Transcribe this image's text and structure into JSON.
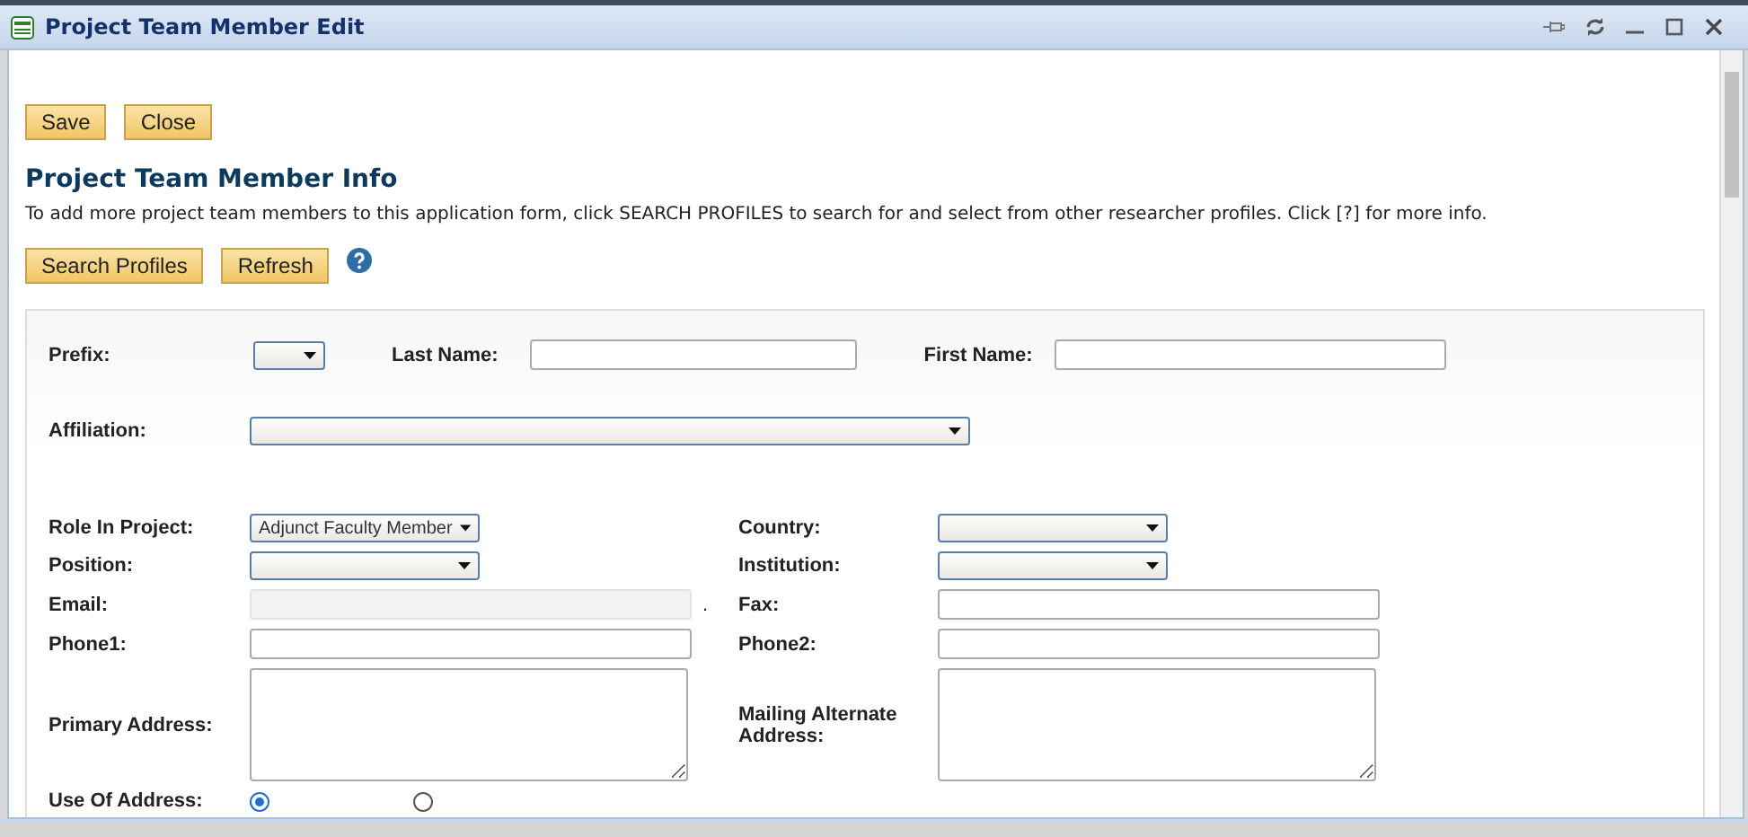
{
  "window": {
    "title": "Project Team Member Edit"
  },
  "toolbar": [
    "Save",
    "Close"
  ],
  "section": {
    "title": "Project Team Member Info",
    "description": "To add more project team members to this application form, click SEARCH PROFILES to search for and select from other researcher profiles. Click [?] for more info."
  },
  "actions": [
    "Search Profiles",
    "Refresh"
  ],
  "form": {
    "name_row": [
      {
        "label": "Prefix:",
        "kind": "select"
      },
      {
        "label": "Last Name:",
        "kind": "text"
      },
      {
        "label": "First Name:",
        "kind": "text"
      }
    ],
    "affiliation": {
      "label": "Affiliation:",
      "kind": "select"
    },
    "rows": [
      {
        "left": {
          "label": "Role In Project:",
          "kind": "select",
          "value": "Adjunct Faculty Member"
        },
        "right": {
          "label": "Country:",
          "kind": "select"
        }
      },
      {
        "left": {
          "label": "Position:",
          "kind": "select"
        },
        "right": {
          "label": "Institution:",
          "kind": "select"
        }
      },
      {
        "left": {
          "label": "Email:",
          "kind": "text",
          "disabled": true,
          "note": "."
        },
        "right": {
          "label": "Fax:",
          "kind": "text",
          "disabled": false
        }
      },
      {
        "left": {
          "label": "Phone1:",
          "kind": "text",
          "disabled": false
        },
        "right": {
          "label": "Phone2:",
          "kind": "text",
          "disabled": false
        }
      },
      {
        "left": {
          "label": "Primary Address:",
          "kind": "textarea"
        },
        "right": {
          "label": "Mailing Alternate Address:",
          "kind": "textarea"
        }
      }
    ],
    "use_of_address": {
      "label": "Use Of Address:",
      "options": [
        {
          "selected": true
        },
        {
          "selected": false
        }
      ]
    }
  }
}
